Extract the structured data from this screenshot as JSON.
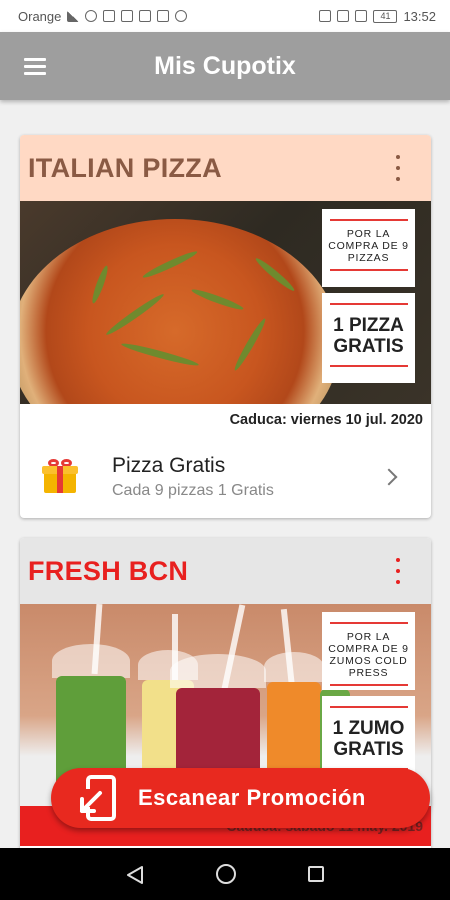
{
  "status_bar": {
    "carrier": "Orange",
    "battery": "41",
    "time": "13:52"
  },
  "app_bar": {
    "title": "Mis Cupotix"
  },
  "cards": [
    {
      "title": "ITALIAN PIZZA",
      "promo_top": "POR LA COMPRA DE 9 PIZZAS",
      "promo_bottom": "1 PIZZA GRATIS",
      "expiry": "Caduca: viernes 10 jul. 2020",
      "reward_title": "Pizza Gratis",
      "reward_subtitle": "Cada 9 pizzas 1 Gratis"
    },
    {
      "title": "FRESH BCN",
      "promo_top": "POR LA COMPRA DE 9 ZUMOS COLD PRESS",
      "promo_bottom": "1 ZUMO GRATIS",
      "expiry": "Caduca: sábado 11 may. 2019"
    }
  ],
  "scan_button": {
    "label": "Escanear Promoción"
  },
  "colors": {
    "app_bar": "#9e9e9e",
    "card1_header": "#ffd9c4",
    "card1_title": "#8a5a44",
    "card2_title": "#e8201f",
    "accent": "#e8291f"
  },
  "icons": [
    "menu-icon",
    "more-vert-icon",
    "gift-icon",
    "chevron-right-icon",
    "scan-icon",
    "nav-back-icon",
    "nav-home-icon",
    "nav-recent-icon"
  ]
}
